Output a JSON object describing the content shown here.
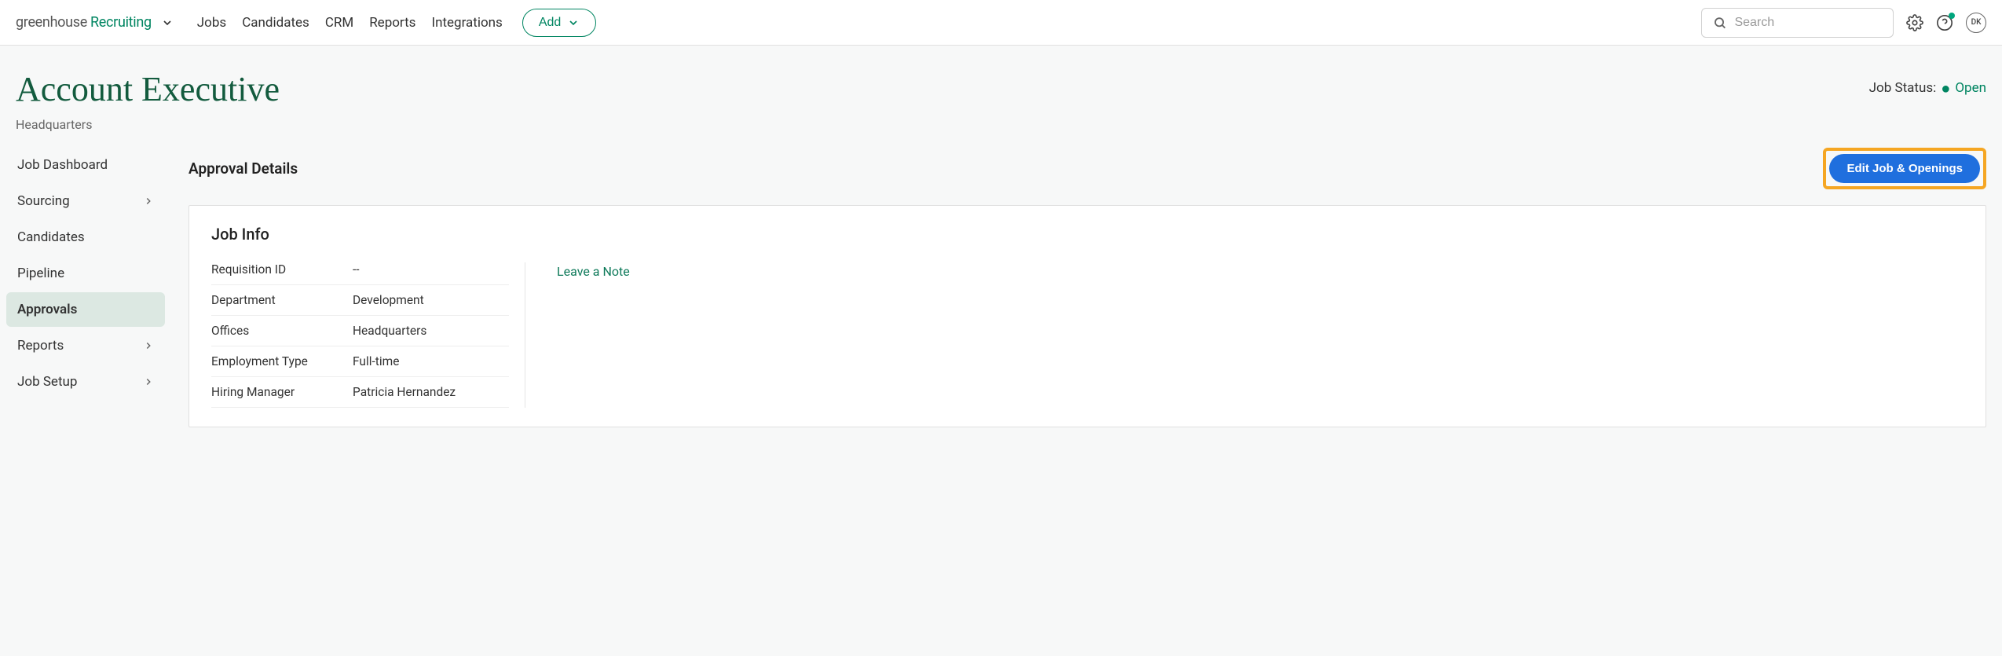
{
  "logo": {
    "part1": "greenhouse",
    "part2": "Recruiting"
  },
  "nav": {
    "items": [
      "Jobs",
      "Candidates",
      "CRM",
      "Reports",
      "Integrations"
    ]
  },
  "add_button": "Add",
  "search": {
    "placeholder": "Search"
  },
  "avatar": "DK",
  "page": {
    "title": "Account Executive",
    "subtitle": "Headquarters"
  },
  "status": {
    "label": "Job Status:",
    "value": "Open"
  },
  "sidebar": {
    "items": [
      {
        "label": "Job Dashboard",
        "chevron": false
      },
      {
        "label": "Sourcing",
        "chevron": true
      },
      {
        "label": "Candidates",
        "chevron": false
      },
      {
        "label": "Pipeline",
        "chevron": false
      },
      {
        "label": "Approvals",
        "chevron": false
      },
      {
        "label": "Reports",
        "chevron": true
      },
      {
        "label": "Job Setup",
        "chevron": true
      }
    ],
    "active_index": 4
  },
  "section": {
    "title": "Approval Details",
    "edit_button": "Edit Job & Openings"
  },
  "card": {
    "title": "Job Info",
    "rows": [
      {
        "label": "Requisition ID",
        "value": "--"
      },
      {
        "label": "Department",
        "value": "Development"
      },
      {
        "label": "Offices",
        "value": "Headquarters"
      },
      {
        "label": "Employment Type",
        "value": "Full-time"
      },
      {
        "label": "Hiring Manager",
        "value": "Patricia Hernandez"
      }
    ],
    "note_link": "Leave a Note"
  }
}
